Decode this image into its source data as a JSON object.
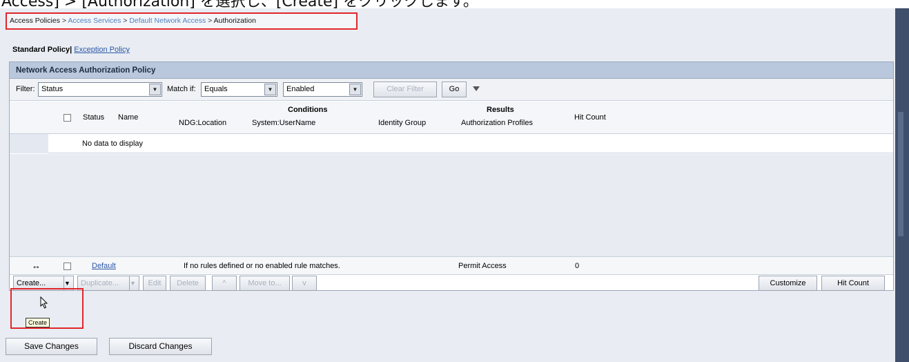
{
  "caption": "Access] > [Authorization] を選択し、[Create] をクリックします。",
  "breadcrumb": {
    "items": [
      "Access Policies",
      "Access Services",
      "Default Network Access",
      "Authorization"
    ],
    "separator": " > "
  },
  "policy_tabs": {
    "standard": "Standard Policy",
    "separator": "|",
    "exception": "Exception Policy"
  },
  "panel": {
    "title": "Network Access Authorization Policy"
  },
  "filter": {
    "label": "Filter:",
    "field_value": "Status",
    "match_label": "Match if:",
    "match_value": "Equals",
    "value_value": "Enabled",
    "clear_label": "Clear Filter",
    "go_label": "Go"
  },
  "table": {
    "headers": {
      "status": "Status",
      "name": "Name",
      "conditions": "Conditions",
      "results": "Results",
      "ndg_location": "NDG:Location",
      "system_username": "System:UserName",
      "identity_group": "Identity Group",
      "authorization_profiles": "Authorization Profiles",
      "hit_count": "Hit Count"
    },
    "no_data": "No data to display",
    "default_row": {
      "handle": "↔",
      "name": "Default",
      "conditions": "If no rules defined or no enabled rule matches.",
      "result": "Permit Access",
      "hit_count": "0"
    }
  },
  "actions": {
    "create": "Create...",
    "duplicate": "Duplicate...",
    "edit": "Edit",
    "delete": "Delete",
    "up": "^",
    "move_to": "Move to...",
    "down": "v",
    "customize": "Customize",
    "hit_count": "Hit Count"
  },
  "tooltip": "Create",
  "bottom": {
    "save": "Save Changes",
    "discard": "Discard Changes"
  },
  "colors": {
    "highlight_red": "#e0252b",
    "panel_header": "#b9c8dc",
    "link_blue": "#2a55a5"
  }
}
